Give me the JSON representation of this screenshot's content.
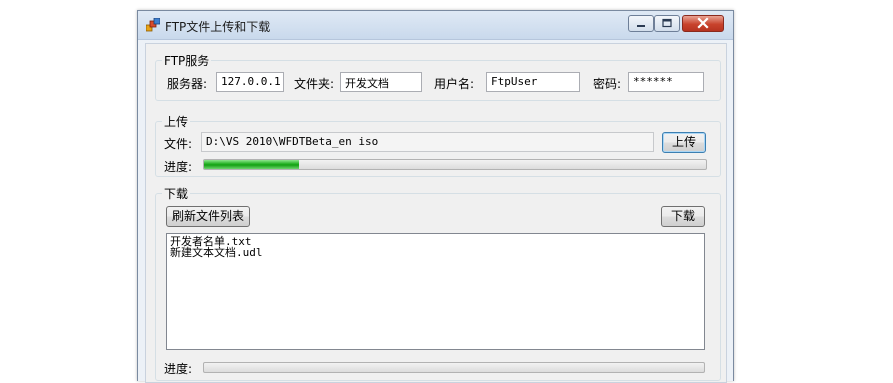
{
  "window": {
    "title": "FTP文件上传和下载",
    "controls": {
      "minimize": "minimize",
      "maximize": "maximize",
      "close": "close"
    }
  },
  "ftp_service": {
    "group_label": "FTP服务",
    "server_label": "服务器:",
    "server_value": "127.0.0.1",
    "folder_label": "文件夹:",
    "folder_value": "开发文档",
    "username_label": "用户名:",
    "username_value": "FtpUser",
    "password_label": "密码:",
    "password_value": "******"
  },
  "upload": {
    "group_label": "上传",
    "file_label": "文件:",
    "file_value": "D:\\VS 2010\\WFDTBeta_en iso",
    "button_label": "上传",
    "progress_label": "进度:",
    "progress_fraction": 0.19
  },
  "download": {
    "group_label": "下载",
    "refresh_button_label": "刷新文件列表",
    "download_button_label": "下载",
    "files": [
      "开发者名单.txt",
      "新建文本文档.udl"
    ],
    "progress_label": "进度:",
    "progress_fraction": 0
  },
  "colors": {
    "progress_fill": "#20b020",
    "close_button": "#c8432d",
    "title_bar": "#c9d9ec"
  }
}
